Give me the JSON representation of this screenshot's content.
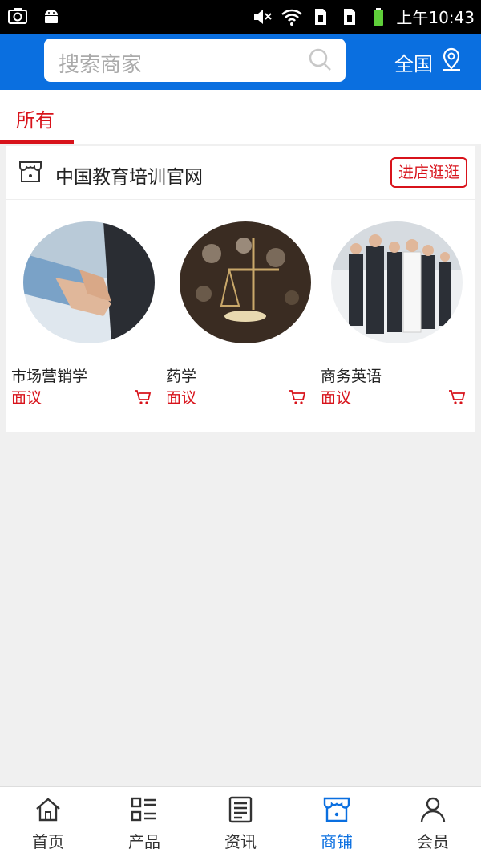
{
  "status_bar": {
    "time": "上午10:43"
  },
  "header": {
    "search_placeholder": "搜索商家",
    "region_label": "全国"
  },
  "tabs": [
    {
      "label": "所有",
      "active": true
    }
  ],
  "shop": {
    "name": "中国教育培训官网",
    "enter_button": "进店逛逛",
    "products": [
      {
        "name": "市场营销学",
        "price": "面议"
      },
      {
        "name": "药学",
        "price": "面议"
      },
      {
        "name": "商务英语",
        "price": "面议"
      }
    ]
  },
  "bottom_nav": [
    {
      "label": "首页",
      "icon": "home-icon"
    },
    {
      "label": "产品",
      "icon": "list-icon"
    },
    {
      "label": "资讯",
      "icon": "news-icon"
    },
    {
      "label": "商铺",
      "icon": "shop-icon",
      "active": true
    },
    {
      "label": "会员",
      "icon": "user-icon"
    }
  ],
  "colors": {
    "brand_blue": "#0a6fe0",
    "accent_red": "#d8131b"
  }
}
